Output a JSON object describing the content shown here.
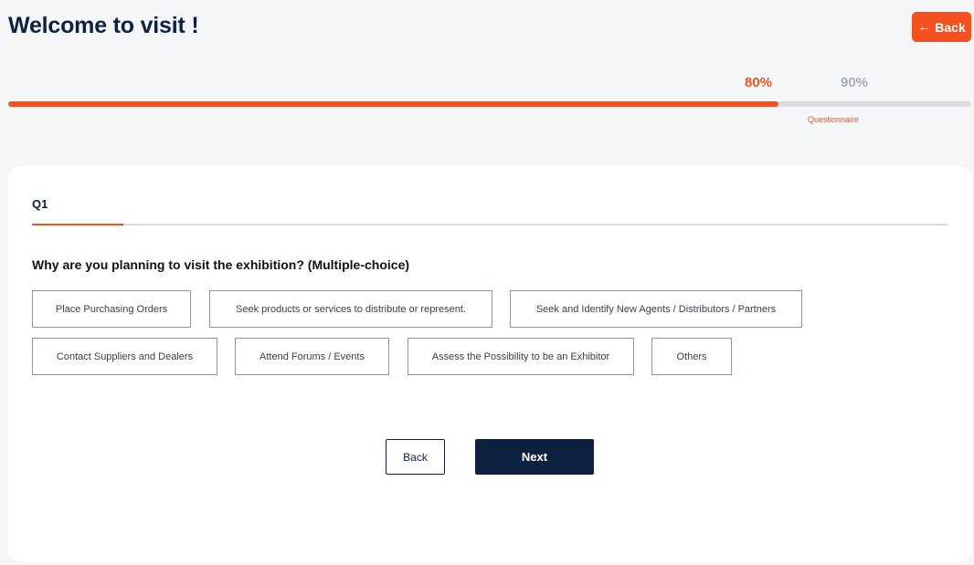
{
  "header": {
    "title": "Welcome to visit !",
    "back_label": "Back",
    "back_icon": "arrow-left-icon"
  },
  "progress": {
    "current_label": "80%",
    "next_label": "90%",
    "value_percent": 80,
    "step_label": "Questionnaire"
  },
  "question_tab": {
    "label": "Q1"
  },
  "question": {
    "text": "Why are you planning to visit the exhibition? (Multiple-choice)",
    "options": [
      "Place Purchasing Orders",
      "Seek products or services to distribute or represent.",
      "Seek and Identify New Agents / Distributors / Partners",
      "Contact Suppliers and Dealers",
      "Attend Forums / Events",
      "Assess the Possibility to be an Exhibitor",
      "Others"
    ]
  },
  "actions": {
    "back_label": "Back",
    "next_label": "Next"
  },
  "colors": {
    "accent": "#f4511e",
    "navy": "#0d2240",
    "track": "#d9dbdf"
  }
}
